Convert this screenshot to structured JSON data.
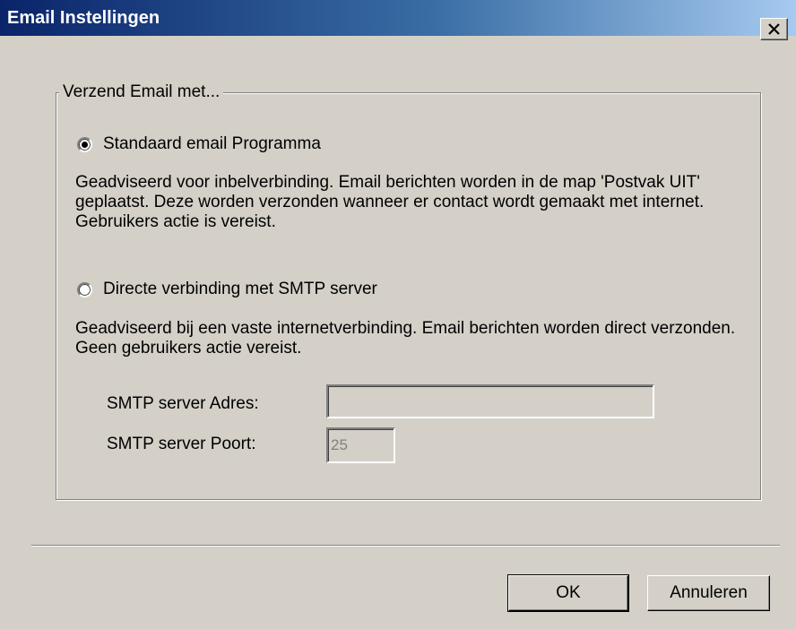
{
  "window": {
    "title": "Email Instellingen"
  },
  "group": {
    "legend": "Verzend Email met...",
    "option_default": {
      "label": "Standaard email Programma",
      "checked": true,
      "description": "Geadviseerd voor inbelverbinding. Email berichten worden in de map 'Postvak UIT' geplaatst. Deze worden verzonden wanneer er contact wordt gemaakt met internet. Gebruikers actie is vereist."
    },
    "option_smtp": {
      "label": "Directe verbinding met SMTP server",
      "checked": false,
      "description": "Geadviseerd bij een vaste internetverbinding. Email berichten worden direct verzonden. Geen gebruikers actie vereist."
    },
    "smtp_address": {
      "label": "SMTP server Adres:",
      "value": ""
    },
    "smtp_port": {
      "label": "SMTP server Poort:",
      "value": "25"
    }
  },
  "buttons": {
    "ok": "OK",
    "cancel": "Annuleren"
  },
  "colors": {
    "face": "#d4d0c8",
    "title_start": "#0a246a",
    "title_end": "#a6caf0"
  },
  "icons": {
    "close": "close-icon"
  }
}
